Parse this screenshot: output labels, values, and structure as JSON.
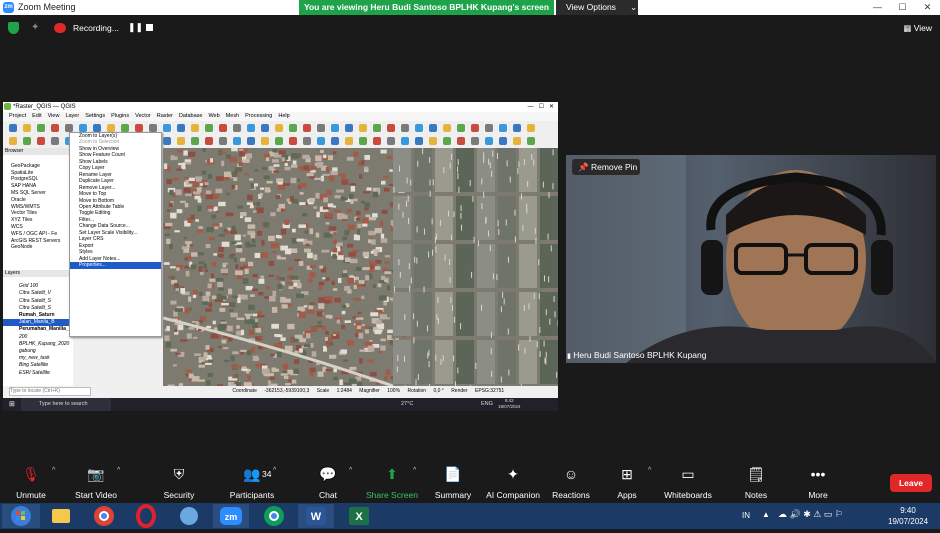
{
  "window": {
    "title": "Zoom Meeting",
    "logo": "zm",
    "min": "—",
    "max": "☐",
    "close": "✕"
  },
  "banner": {
    "text": "You are viewing Heru Budi Santoso BPLHK Kupang's screen"
  },
  "view_options": {
    "label": "View Options"
  },
  "recording": {
    "label": "Recording...",
    "view_label": "View"
  },
  "qgis": {
    "title": "*Raster_QGIS — QGIS",
    "menu": [
      "Project",
      "Edit",
      "View",
      "Layer",
      "Settings",
      "Plugins",
      "Vector",
      "Raster",
      "Database",
      "Web",
      "Mesh",
      "Processing",
      "Help"
    ],
    "browser_header": "Browser",
    "browser_items": [
      "GeoPackage",
      "SpatiaLite",
      "PostgreSQL",
      "SAP HANA",
      "MS SQL Server",
      "Oracle",
      "WMS/WMTS",
      "Vector Tiles",
      "XYZ Tiles",
      "WCS",
      "WFS / OGC API - Fe",
      "ArcGIS REST Servers",
      "GeoNode"
    ],
    "layers_header": "Layers",
    "layers": [
      "Grid 100",
      "Citra Satelit_V",
      "Citra Satelit_S",
      "Citra Satelit_S",
      "Rumah_Saturn",
      "Jalan_Manila_B",
      "Perumahan_Manilla_Rengganis_Blok_D",
      "200",
      "BPLHK_Kupang_2020",
      "gabung",
      "my_new_task",
      "Bing Satellite",
      "ESRI Satellite"
    ],
    "context_menu": [
      "Zoom to Layer(s)",
      "Zoom to Selection",
      "Show in Overview",
      "Show Feature Count",
      "Show Labels",
      "Copy Layer",
      "Rename Layer",
      "Duplicate Layer",
      "Remove Layer...",
      "Move to Top",
      "Move to Bottom",
      "Open Attribute Table",
      "Toggle Editing",
      "Filter...",
      "Change Data Source...",
      "Set Layer Scale Visibility...",
      "Layer CRS",
      "Export",
      "Styles",
      "Add Layer Notes...",
      "Properties..."
    ],
    "status": {
      "search_placeholder": "Type to locate (Ctrl+K)",
      "coord_label": "Coordinate",
      "coord": "-362153,-5939100,3",
      "scale_label": "Scale",
      "scale": "1:2484",
      "magnifier_label": "Magnifier",
      "magnifier": "100%",
      "rotation_label": "Rotation",
      "rotation": "0,0 °",
      "render": "Render",
      "crs": "EPSG:32751"
    },
    "win_taskbar": {
      "search": "Type here to search",
      "temp": "27°C",
      "lang": "ENG",
      "time": "9:42",
      "date": "19/07/2024"
    }
  },
  "video": {
    "pin_label": "Remove Pin",
    "name": "Heru Budi Santoso BPLHK Kupang"
  },
  "controls": [
    {
      "label": "Unmute",
      "icon": "mic-muted-icon"
    },
    {
      "label": "Start Video",
      "icon": "video-off-icon"
    },
    {
      "label": "Security",
      "icon": "shield-icon"
    },
    {
      "label": "Participants",
      "icon": "participants-icon",
      "badge": "34"
    },
    {
      "label": "Chat",
      "icon": "chat-icon"
    },
    {
      "label": "Share Screen",
      "icon": "share-screen-icon"
    },
    {
      "label": "Summary",
      "icon": "summary-icon"
    },
    {
      "label": "AI Companion",
      "icon": "ai-sparkle-icon"
    },
    {
      "label": "Reactions",
      "icon": "reactions-icon"
    },
    {
      "label": "Apps",
      "icon": "apps-icon"
    },
    {
      "label": "Whiteboards",
      "icon": "whiteboard-icon"
    },
    {
      "label": "Notes",
      "icon": "notes-icon"
    },
    {
      "label": "More",
      "icon": "more-icon"
    }
  ],
  "leave": {
    "label": "Leave"
  },
  "taskbar": {
    "lang": "IN",
    "time": "9:40",
    "date": "19/07/2024",
    "apps": [
      "zm"
    ]
  },
  "colors": {
    "accent": "#2d8cff",
    "leave": "#e02828",
    "share": "#1fa34a",
    "taskbar": "#1c3a66"
  }
}
